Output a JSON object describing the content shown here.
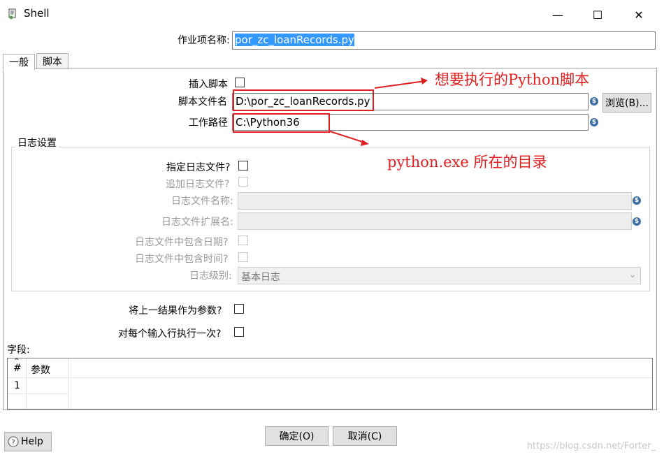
{
  "window": {
    "title": "Shell",
    "minimize_glyph": "—",
    "maximize_glyph": "☐",
    "close_glyph": "✕"
  },
  "job_name": {
    "label": "作业项名称:",
    "value": "por_zc_loanRecords.py"
  },
  "tabs": [
    {
      "label": "一般",
      "active": true
    },
    {
      "label": "脚本",
      "active": false
    }
  ],
  "general": {
    "insert_script_label": "插入脚本",
    "script_file_label": "脚本文件名",
    "script_file_value": "D:\\por_zc_loanRecords.py",
    "browse_label": "浏览(B)...",
    "work_dir_label": "工作路径",
    "work_dir_value": "C:\\Python36"
  },
  "annotations": {
    "script_note": "想要执行的Python脚本",
    "dir_note": "python.exe 所在的目录"
  },
  "log_settings": {
    "title": "日志设置",
    "specify_log_file": "指定日志文件?",
    "append_log_file": "追加日志文件?",
    "log_file_name": "日志文件名称:",
    "log_file_ext": "日志文件扩展名:",
    "include_date": "日志文件中包含日期?",
    "include_time": "日志文件中包含时间?",
    "log_level_label": "日志级别:",
    "log_level_value": "基本日志"
  },
  "options": {
    "prev_result_as_args": "将上一结果作为参数?",
    "exec_each_row": "对每个输入行执行一次?"
  },
  "fields": {
    "label": "字段:",
    "columns": [
      "#",
      "参数"
    ],
    "rows": [
      [
        "1",
        ""
      ]
    ]
  },
  "footer": {
    "help_label": "Help",
    "ok_label": "确定(O)",
    "cancel_label": "取消(C)"
  },
  "watermark": "https://blog.csdn.net/Forter_",
  "colors": {
    "annotation": "#e02020",
    "selection": "#3399ff"
  },
  "icons": {
    "app": "shell-script-icon",
    "variable": "dollar-variable-icon",
    "help": "help-icon"
  }
}
